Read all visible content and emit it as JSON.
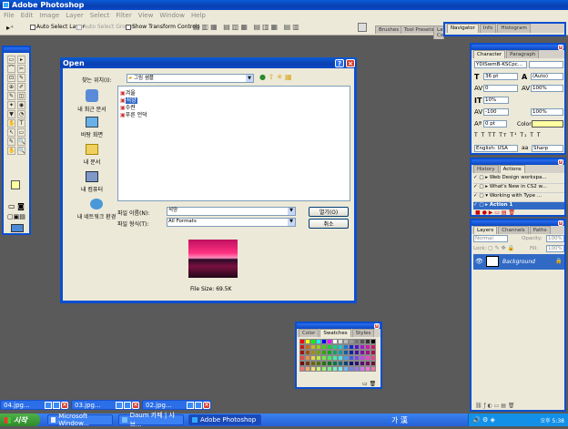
{
  "app": {
    "title": "Adobe Photoshop"
  },
  "menu": [
    "File",
    "Edit",
    "Image",
    "Layer",
    "Select",
    "Filter",
    "View",
    "Window",
    "Help"
  ],
  "options": {
    "auto_select_layer": "Auto Select Layer",
    "auto_select_groups": "Auto Select Groups",
    "show_transform": "Show Transform Controls"
  },
  "wells": [
    "Brushes",
    "Tool Presets",
    "Layer Comps"
  ],
  "top_right_tabs": [
    "Navigator",
    "Info",
    "Histogram"
  ],
  "dialog": {
    "title": "Open",
    "lookin_label": "찾는 위치(I):",
    "lookin_value": "그림 샘플",
    "places": [
      "내 최근 문서",
      "바탕 화면",
      "내 문서",
      "내 컴퓨터",
      "내 네트워크 환경"
    ],
    "files": [
      "겨울",
      "석양",
      "수련",
      "푸른 언덕"
    ],
    "selected_file": "석양",
    "filename_label": "파일 이름(N):",
    "filename_value": "석양",
    "filetype_label": "파일 형식(T):",
    "filetype_value": "All Formats",
    "open_btn": "열기(O)",
    "cancel_btn": "취소",
    "filesize": "File Size: 69.5K"
  },
  "character": {
    "tabs": [
      "Character",
      "Paragraph"
    ],
    "font_family": "YDISwmB-KSCpc...",
    "font_size": "36 pt",
    "leading": "(Auto)",
    "tracking": "-100",
    "kerning": "0",
    "scale_v": "100%",
    "scale_h": "100%",
    "vertical_pct": "10%",
    "baseline": "0 pt",
    "color_label": "Color:",
    "language": "English: USA",
    "aa_label": "aa",
    "aa_value": "Sharp"
  },
  "history": {
    "tabs": [
      "History",
      "Actions"
    ],
    "items": [
      "Web Design workspa...",
      "What's New in CS2 w...",
      "Working with Type ...",
      "Action 1"
    ]
  },
  "layers": {
    "tabs": [
      "Layers",
      "Channels",
      "Paths"
    ],
    "mode": "Normal",
    "opacity_label": "Opacity:",
    "opacity": "100%",
    "lock_label": "Lock:",
    "fill_label": "Fill:",
    "fill": "100%",
    "layer_name": "Background"
  },
  "swatches": {
    "tabs": [
      "Color",
      "Swatches",
      "Styles"
    ]
  },
  "docs": [
    "04.jpg...",
    "03.jpg...",
    "02.jpg..."
  ],
  "taskbar": {
    "start": "시작",
    "items": [
      "Microsoft Window...",
      "Daum 카페 | 샤브...",
      "Adobe Photoshop"
    ],
    "ime": "가 漢",
    "clock": "오후 5:38"
  },
  "colors": {
    "xp_blue": "#0a4fd0",
    "selection": "#316ac5",
    "dialog_bg": "#ece9d8",
    "fg_swatch": "#ffffa0"
  }
}
